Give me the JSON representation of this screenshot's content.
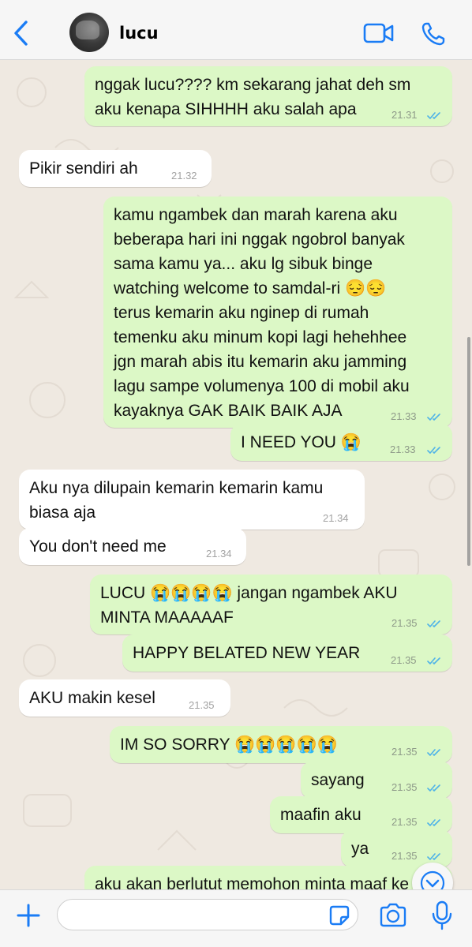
{
  "header": {
    "contact_name": "lucu",
    "accent_color": "#1a7cf5"
  },
  "messages": [
    {
      "dir": "out",
      "lines": [
        "nggak lucu???? km sekarang jahat deh sm",
        "aku kenapa SIHHHH aku salah apa"
      ],
      "time": "21.31",
      "read": true
    },
    {
      "dir": "in",
      "lines": [
        "Pikir sendiri ah"
      ],
      "time": "21.32"
    },
    {
      "dir": "out",
      "lines": [
        "kamu ngambek dan marah karena aku",
        "beberapa hari ini nggak ngobrol banyak",
        "sama kamu ya... aku lg sibuk binge",
        "watching welcome to samdal-ri 😔😔",
        "terus kemarin aku nginep di rumah",
        "temenku aku minum kopi lagi hehehhee",
        "jgn marah abis itu kemarin aku jamming",
        "lagu sampe volumenya 100 di mobil aku",
        "kayaknya GAK BAIK BAIK AJA"
      ],
      "time": "21.33",
      "read": true
    },
    {
      "dir": "out",
      "lines": [
        "I NEED YOU 😭"
      ],
      "time": "21.33",
      "read": true
    },
    {
      "dir": "in",
      "lines": [
        "Aku nya dilupain kemarin kemarin kamu",
        "biasa aja"
      ],
      "time": "21.34"
    },
    {
      "dir": "in",
      "lines": [
        "You don't need me"
      ],
      "time": "21.34"
    },
    {
      "dir": "out",
      "lines": [
        "LUCU 😭😭😭😭 jangan ngambek AKU",
        "MINTA MAAAAAF"
      ],
      "time": "21.35",
      "read": true
    },
    {
      "dir": "out",
      "lines": [
        "HAPPY BELATED NEW YEAR"
      ],
      "time": "21.35",
      "read": true
    },
    {
      "dir": "in",
      "lines": [
        "AKU makin kesel"
      ],
      "time": "21.35"
    },
    {
      "dir": "out",
      "lines": [
        "IM SO SORRY 😭😭😭😭😭"
      ],
      "time": "21.35",
      "read": true
    },
    {
      "dir": "out",
      "lines": [
        "sayang"
      ],
      "time": "21.35",
      "read": true
    },
    {
      "dir": "out",
      "lines": [
        "maafin aku"
      ],
      "time": "21.35",
      "read": true
    },
    {
      "dir": "out",
      "lines": [
        "ya"
      ],
      "time": "21.35",
      "read": true
    },
    {
      "dir": "out",
      "lines": [
        "aku akan berlutut memohon minta maaf ke"
      ],
      "time": "",
      "read": false
    }
  ],
  "input": {
    "value": ""
  },
  "colors": {
    "outgoing_bubble": "#dcf8c6",
    "incoming_bubble": "#ffffff",
    "read_check": "#4fb3e8",
    "chat_background": "#efe9e1"
  }
}
